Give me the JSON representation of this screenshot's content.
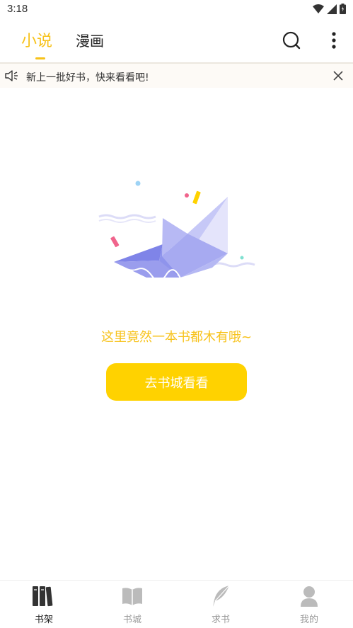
{
  "status_bar": {
    "time": "3:18"
  },
  "tabs": [
    {
      "label": "小说",
      "active": true
    },
    {
      "label": "漫画",
      "active": false
    }
  ],
  "top_icons": [
    "search-icon",
    "more-vertical-icon"
  ],
  "notice": {
    "text": "新上一批好书，快来看看吧!"
  },
  "empty_state": {
    "message": "这里竟然一本书都木有哦~",
    "button_label": "去书城看看"
  },
  "bottom_nav": [
    {
      "label": "书架",
      "icon": "bookshelf-icon",
      "active": true
    },
    {
      "label": "书城",
      "icon": "open-book-icon",
      "active": false
    },
    {
      "label": "求书",
      "icon": "feather-icon",
      "active": false
    },
    {
      "label": "我的",
      "icon": "user-icon",
      "active": false
    }
  ],
  "colors": {
    "accent": "#f7c21a",
    "button": "#ffd200"
  }
}
